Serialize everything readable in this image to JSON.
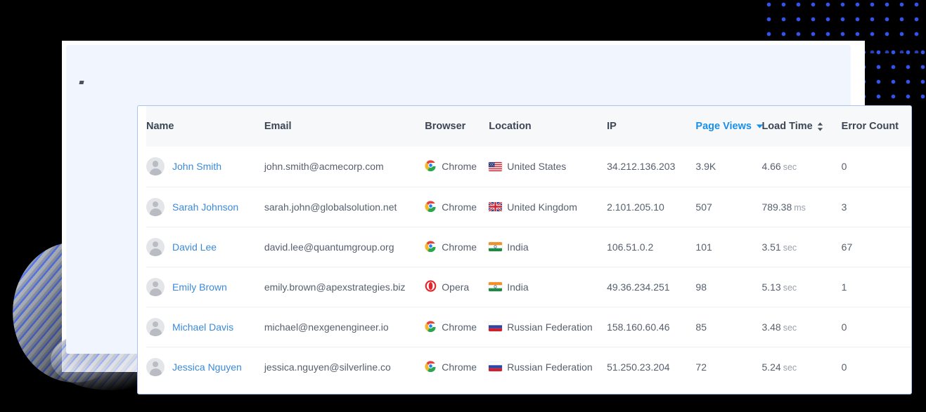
{
  "table": {
    "columns": [
      {
        "key": "name",
        "label": "Name",
        "sortable": true,
        "sort_state": "none"
      },
      {
        "key": "email",
        "label": "Email",
        "sortable": true,
        "sort_state": "none"
      },
      {
        "key": "browser",
        "label": "Browser",
        "sortable": true,
        "sort_state": "none"
      },
      {
        "key": "location",
        "label": "Location",
        "sortable": true,
        "sort_state": "none"
      },
      {
        "key": "ip",
        "label": "IP",
        "sortable": true,
        "sort_state": "none"
      },
      {
        "key": "views",
        "label": "Page Views",
        "sortable": true,
        "sort_state": "desc"
      },
      {
        "key": "load",
        "label": "Load Time",
        "sortable": true,
        "sort_state": "none"
      },
      {
        "key": "errors",
        "label": "Error Count",
        "sortable": true,
        "sort_state": "none"
      }
    ],
    "rows": [
      {
        "name": "John Smith",
        "email": "john.smith@acmecorp.com",
        "browser": "Chrome",
        "browser_icon": "chrome-icon",
        "location": "United States",
        "flag_icon": "flag-us",
        "ip": "34.212.136.203",
        "page_views": "3.9K",
        "load_time": "4.66",
        "load_unit": "sec",
        "error_count": "0"
      },
      {
        "name": "Sarah Johnson",
        "email": "sarah.john@globalsolution.net",
        "browser": "Chrome",
        "browser_icon": "chrome-icon",
        "location": "United Kingdom",
        "flag_icon": "flag-gb",
        "ip": "2.101.205.10",
        "page_views": "507",
        "load_time": "789.38",
        "load_unit": "ms",
        "error_count": "3"
      },
      {
        "name": "David Lee",
        "email": "david.lee@quantumgroup.org",
        "browser": "Chrome",
        "browser_icon": "chrome-icon",
        "location": "India",
        "flag_icon": "flag-in",
        "ip": "106.51.0.2",
        "page_views": "101",
        "load_time": "3.51",
        "load_unit": "sec",
        "error_count": "67"
      },
      {
        "name": "Emily Brown",
        "email": "emily.brown@apexstrategies.biz",
        "browser": "Opera",
        "browser_icon": "opera-icon",
        "location": "India",
        "flag_icon": "flag-in",
        "ip": "49.36.234.251",
        "page_views": "98",
        "load_time": "5.13",
        "load_unit": "sec",
        "error_count": "1"
      },
      {
        "name": "Michael Davis",
        "email": "michael@nexgenengineer.io",
        "browser": "Chrome",
        "browser_icon": "chrome-icon",
        "location": "Russian Federation",
        "flag_icon": "flag-ru",
        "ip": "158.160.60.46",
        "page_views": "85",
        "load_time": "3.48",
        "load_unit": "sec",
        "error_count": "0"
      },
      {
        "name": "Jessica Nguyen",
        "email": "jessica.nguyen@silverline.co",
        "browser": "Chrome",
        "browser_icon": "chrome-icon",
        "location": "Russian Federation",
        "flag_icon": "flag-ru",
        "ip": "51.250.23.204",
        "page_views": "72",
        "load_time": "5.24",
        "load_unit": "sec",
        "error_count": "0"
      }
    ]
  },
  "theme": {
    "accent_blue": "#1a8fe8",
    "link_blue": "#3b8ad9",
    "card_border": "#a8c4ee",
    "panel_bg": "#f1f5fd",
    "header_bg": "#f7f8fa",
    "text_dark": "#3d4654",
    "text_body": "#57606e",
    "unit_gray": "#9aa1ab",
    "row_divider": "#eceef1",
    "page_bg": "#000000",
    "dot_blue": "#3355ee"
  }
}
